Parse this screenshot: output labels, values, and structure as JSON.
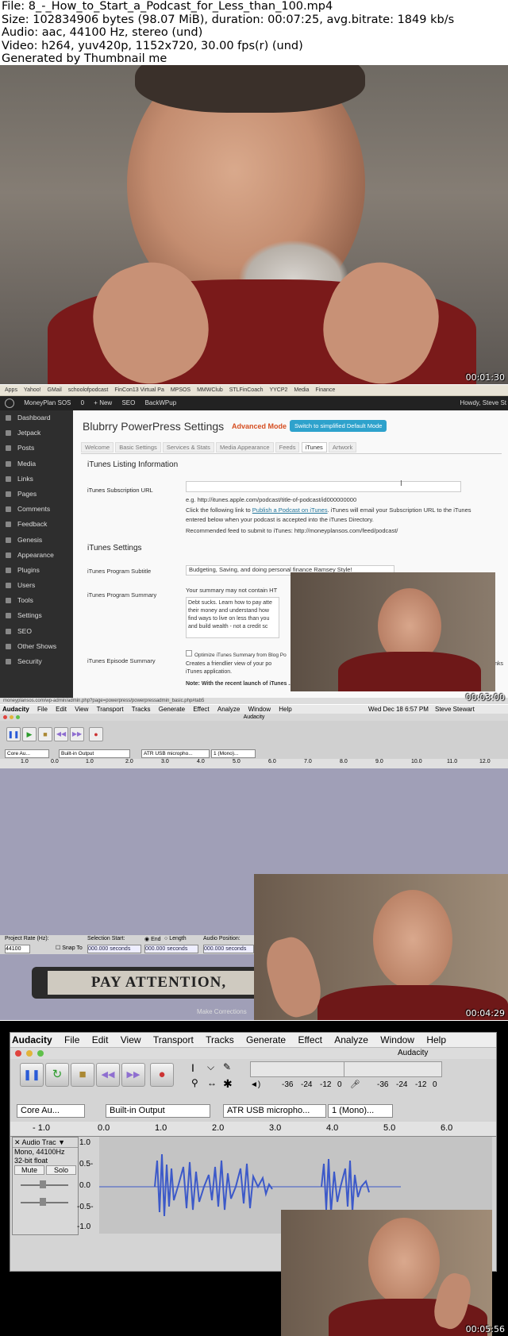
{
  "header": {
    "line1": "File: 8_-_How_to_Start_a_Podcast_for_Less_than_100.mp4",
    "line2": "Size: 102834906 bytes (98.07 MiB), duration: 00:07:25, avg.bitrate: 1849 kb/s",
    "line3": "Audio: aac, 44100 Hz, stereo (und)",
    "line4": "Video: h264, yuv420p, 1152x720, 30.00 fps(r) (und)",
    "line5": "Generated by Thumbnail me"
  },
  "timestamps": [
    "00:01:30",
    "00:03:00",
    "00:04:29",
    "00:05:56"
  ],
  "browser": {
    "bookmarks": [
      "Apps",
      "Yahoo!",
      "GMail",
      "schoolofpodcast",
      "FinCon13 Virtual Pa",
      "MPSOS",
      "MMWClub",
      "STLFinCoach",
      "YYCP2",
      "Media",
      "Finance"
    ],
    "status_url": "moneyplansos.com/wp-admin/admin.php?page=powerpress/powerpressadmin_basic.php#tab5"
  },
  "wordpress": {
    "topbar": [
      "MoneyPlan SOS",
      "0",
      "+ New",
      "SEO",
      "BackWPup",
      "Howdy, Steve St"
    ],
    "sidebar": [
      "Dashboard",
      "Jetpack",
      "Posts",
      "Media",
      "Links",
      "Pages",
      "Comments",
      "Feedback",
      "Genesis",
      "Appearance",
      "Plugins",
      "Users",
      "Tools",
      "Settings",
      "SEO",
      "Other Shows",
      "Security"
    ],
    "page_title": "Blubrry PowerPress Settings",
    "advanced_mode": "Advanced Mode",
    "switch_button": "Switch to simplified Default Mode",
    "tabs": [
      "Welcome",
      "Basic Settings",
      "Services & Stats",
      "Media Appearance",
      "Feeds",
      "iTunes",
      "Artwork"
    ],
    "section1": "iTunes Listing Information",
    "sub_url_label": "iTunes Subscription URL",
    "sub_url_example": "e.g. http://itunes.apple.com/podcast/title-of-podcast/id000000000",
    "sub_url_help1": "Click the following link to",
    "sub_url_link": "Publish a Podcast on iTunes",
    "sub_url_help2": ". iTunes will email your Subscription URL to the iTunes",
    "sub_url_help3": "entered below when your podcast is accepted into the iTunes Directory.",
    "recommended_feed": "Recommended feed to submit to iTunes: http://moneyplansos.com/feed/podcast/",
    "section2": "iTunes Settings",
    "subtitle_label": "iTunes Program Subtitle",
    "subtitle_value": "Budgeting, Saving, and doing personal finance Ramsey Style!",
    "summary_label": "iTunes Program Summary",
    "summary_note": "Your summary may not contain HT",
    "summary_text": "Debt sucks. Learn how to pay atte their money and understand how find ways to live on less than you and build wealth - not a credit sc",
    "episode_label": "iTunes Episode Summary",
    "episode_check": "Optimize iTunes Summary from Blog Po",
    "episode_help": "Creates a friendlier view of your po iTunes application.",
    "episode_note": "Note: With the recent launch of iTunes ... not appear online in the same way they do in the iTunes application.",
    "links_tail": "links"
  },
  "mac_menubar": {
    "items": [
      "Audacity",
      "File",
      "Edit",
      "View",
      "Transport",
      "Tracks",
      "Generate",
      "Effect",
      "Analyze",
      "Window",
      "Help"
    ],
    "clock": "Wed Dec 18 6:57 PM",
    "user": "Steve Stewart"
  },
  "audacity_small": {
    "title": "Audacity",
    "device_host": "Core Au...",
    "device_out": "Built-in Output",
    "device_in": "ATR USB micropho...",
    "channels": "1 (Mono)...",
    "ruler": [
      "1.0",
      "0.0",
      "1.0",
      "2.0",
      "3.0",
      "4.0",
      "5.0",
      "6.0",
      "7.0",
      "8.0",
      "9.0",
      "10.0",
      "11.0",
      "12.0"
    ],
    "project_rate_label": "Project Rate (Hz):",
    "project_rate": "44100",
    "snap_to": "Snap To",
    "selection_start": "Selection Start:",
    "end_label": "End",
    "length_label": "Length",
    "audio_position": "Audio Position:",
    "sel_value": "000.000 seconds",
    "banner": "PAY ATTENTION,",
    "caption": "Make Corrections"
  },
  "audacity_large": {
    "menu": [
      "Audacity",
      "File",
      "Edit",
      "View",
      "Transport",
      "Tracks",
      "Generate",
      "Effect",
      "Analyze",
      "Window",
      "Help"
    ],
    "title": "Audacity",
    "meter_labels": [
      "-36",
      "-24",
      "-12",
      "0"
    ],
    "device_host": "Core Au...",
    "device_out": "Built-in Output",
    "device_in": "ATR USB micropho...",
    "channels": "1 (Mono)...",
    "ruler": [
      "- 1.0",
      "0.0",
      "1.0",
      "2.0",
      "3.0",
      "4.0",
      "5.0",
      "6.0"
    ],
    "track_name": "Audio Trac",
    "track_info1": "Mono, 44100Hz",
    "track_info2": "32-bit float",
    "mute": "Mute",
    "solo": "Solo",
    "scale": [
      "1.0",
      "0.5-",
      "0.0",
      "-0.5-",
      "-1.0"
    ]
  }
}
